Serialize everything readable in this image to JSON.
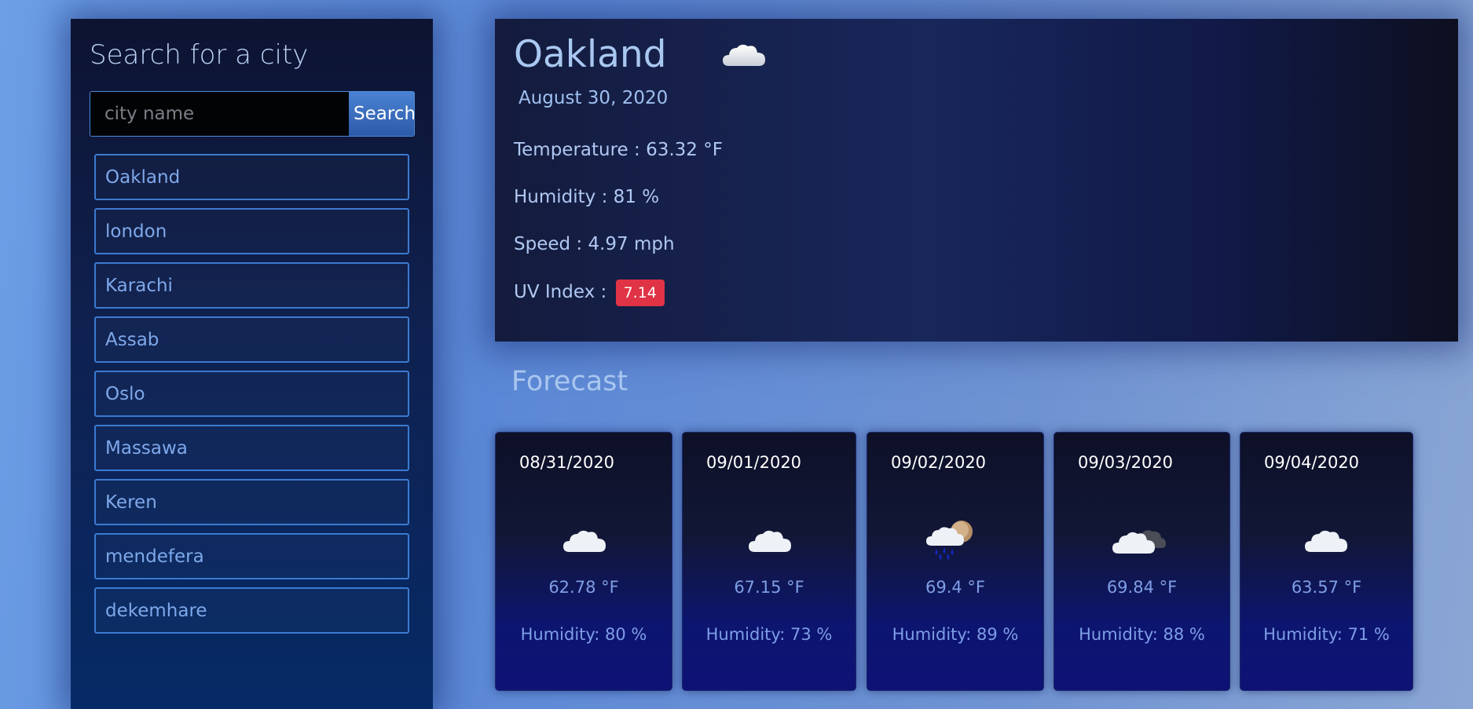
{
  "sidebar": {
    "title": "Search for a city",
    "search": {
      "placeholder": "city name",
      "value": "",
      "button_label": "Search"
    },
    "cities": [
      "Oakland",
      "london",
      "Karachi",
      "Assab",
      "Oslo",
      "Massawa",
      "Keren",
      "mendefera",
      "dekemhare"
    ]
  },
  "current": {
    "city": "Oakland",
    "icon": "cloud-icon",
    "date": "August 30, 2020",
    "temperature": "Temperature : 63.32 °F",
    "humidity": "Humidity : 81 %",
    "speed": "Speed : 4.97 mph",
    "uv_label": "UV Index :",
    "uv_value": "7.14",
    "uv_color": "#e03345"
  },
  "forecast": {
    "title": "Forecast",
    "days": [
      {
        "date": "08/31/2020",
        "icon": "cloud-icon",
        "temp": "62.78 °F",
        "humidity": "Humidity: 80 %"
      },
      {
        "date": "09/01/2020",
        "icon": "cloud-icon",
        "temp": "67.15 °F",
        "humidity": "Humidity: 73 %"
      },
      {
        "date": "09/02/2020",
        "icon": "rain-cloud-sun-icon",
        "temp": "69.4 °F",
        "humidity": "Humidity: 89 %"
      },
      {
        "date": "09/03/2020",
        "icon": "cloud-dark-cloud-icon",
        "temp": "69.84 °F",
        "humidity": "Humidity: 88 %"
      },
      {
        "date": "09/04/2020",
        "icon": "cloud-icon",
        "temp": "63.57 °F",
        "humidity": "Humidity: 71 %"
      }
    ]
  },
  "colors": {
    "accent": "#3b7ad0",
    "uv_badge": "#e03345",
    "sidebar_bg": "#0f2150",
    "card_bg": "#0c1570"
  }
}
